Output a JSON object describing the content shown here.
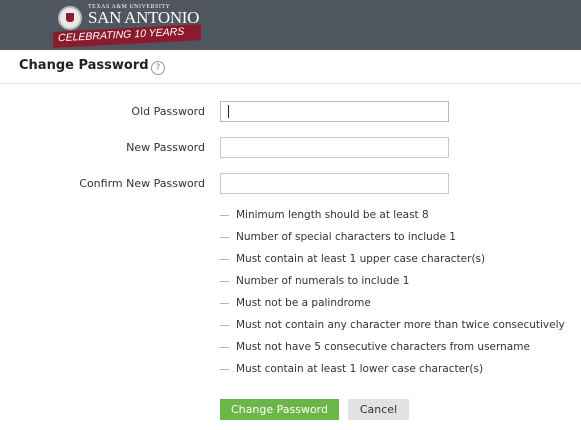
{
  "branding": {
    "university_small": "TEXAS A&M UNIVERSITY",
    "university_name": "SAN ANTONIO",
    "banner_text": "CELEBRATING 10 YEARS",
    "topbar_color": "#4f565f",
    "banner_color": "#8b1a2c"
  },
  "header": {
    "title": "Change Password",
    "help_icon": "?"
  },
  "form": {
    "old_password": {
      "label": "Old Password",
      "value": ""
    },
    "new_password": {
      "label": "New Password",
      "value": ""
    },
    "confirm_password": {
      "label": "Confirm New Password",
      "value": ""
    }
  },
  "rules": [
    "Minimum length should be at least 8",
    "Number of special characters to include 1",
    "Must contain at least 1 upper case character(s)",
    "Number of numerals to include 1",
    "Must not be a palindrome",
    "Must not contain any character more than twice consecutively",
    "Must not have 5 consecutive characters from username",
    "Must contain at least 1 lower case character(s)"
  ],
  "buttons": {
    "submit_label": "Change Password",
    "cancel_label": "Cancel",
    "submit_color": "#6cb548"
  }
}
